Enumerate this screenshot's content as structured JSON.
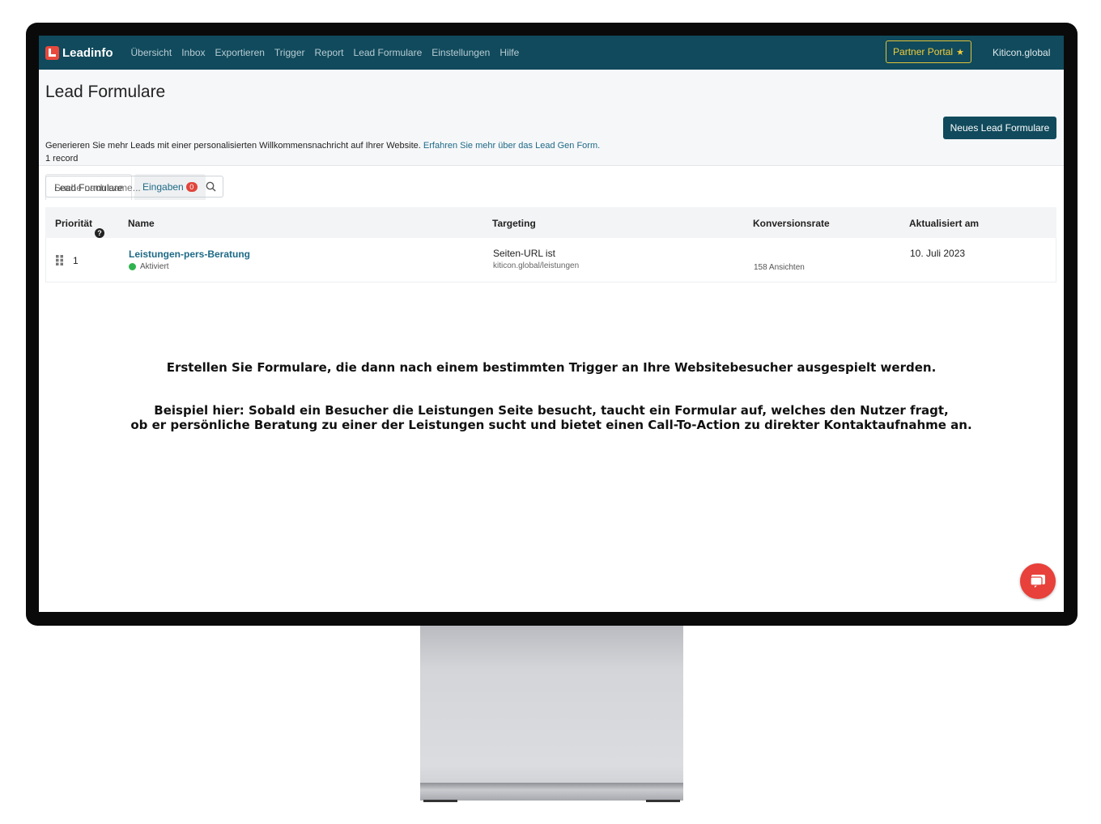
{
  "app": {
    "logo_text": "Leadinfo",
    "account": "Kiticon.global",
    "partner_label": "Partner Portal"
  },
  "nav": [
    "Übersicht",
    "Inbox",
    "Exportieren",
    "Trigger",
    "Report",
    "Lead Formulare",
    "Einstellungen",
    "Hilfe"
  ],
  "page": {
    "title": "Lead Formulare",
    "description": "Generieren Sie mehr Leads mit einer personalisierten Willkommensnachricht auf Ihrer Website.",
    "link": "Erfahren Sie mehr über das Lead Gen Form.",
    "records": "1 record",
    "new_button": "Neues Lead Formulare"
  },
  "tabs": {
    "active": "Lead Formulare",
    "second": "Eingaben",
    "second_badge": "0"
  },
  "search": {
    "placeholder": "Suche nach name..."
  },
  "table": {
    "headers": {
      "priority": "Priorität",
      "name": "Name",
      "targeting": "Targeting",
      "conversion": "Konversionsrate",
      "updated": "Aktualisiert am"
    },
    "rows": [
      {
        "priority": "1",
        "name": "Leistungen-pers-Beratung",
        "status": "Aktiviert",
        "targeting": "Seiten-URL ist",
        "targeting_url": "kiticon.global/leistungen",
        "views": "158 Ansichten",
        "updated": "10. Juli 2023"
      }
    ]
  },
  "overlay": {
    "line1": "Erstellen Sie Formulare, die dann nach einem bestimmten Trigger an Ihre Websitebesucher ausgespielt werden.",
    "line2": "Beispiel hier: Sobald ein Besucher die Leistungen Seite besucht, taucht ein Formular auf, welches den Nutzer fragt,",
    "line3": "ob er persönliche Beratung zu einer der Leistungen sucht und bietet einen Call-To-Action zu direkter Kontaktaufnahme an."
  },
  "colors": {
    "topbar": "#104a5c",
    "accent": "#1e6a86",
    "partner": "#f0cc3c",
    "chat": "#e8403a",
    "status_active": "#2fb34f"
  },
  "icons": {
    "search": "search-icon",
    "chat": "chat-icon",
    "drag": "drag-handle-icon",
    "help": "help-icon",
    "star": "star-icon"
  }
}
